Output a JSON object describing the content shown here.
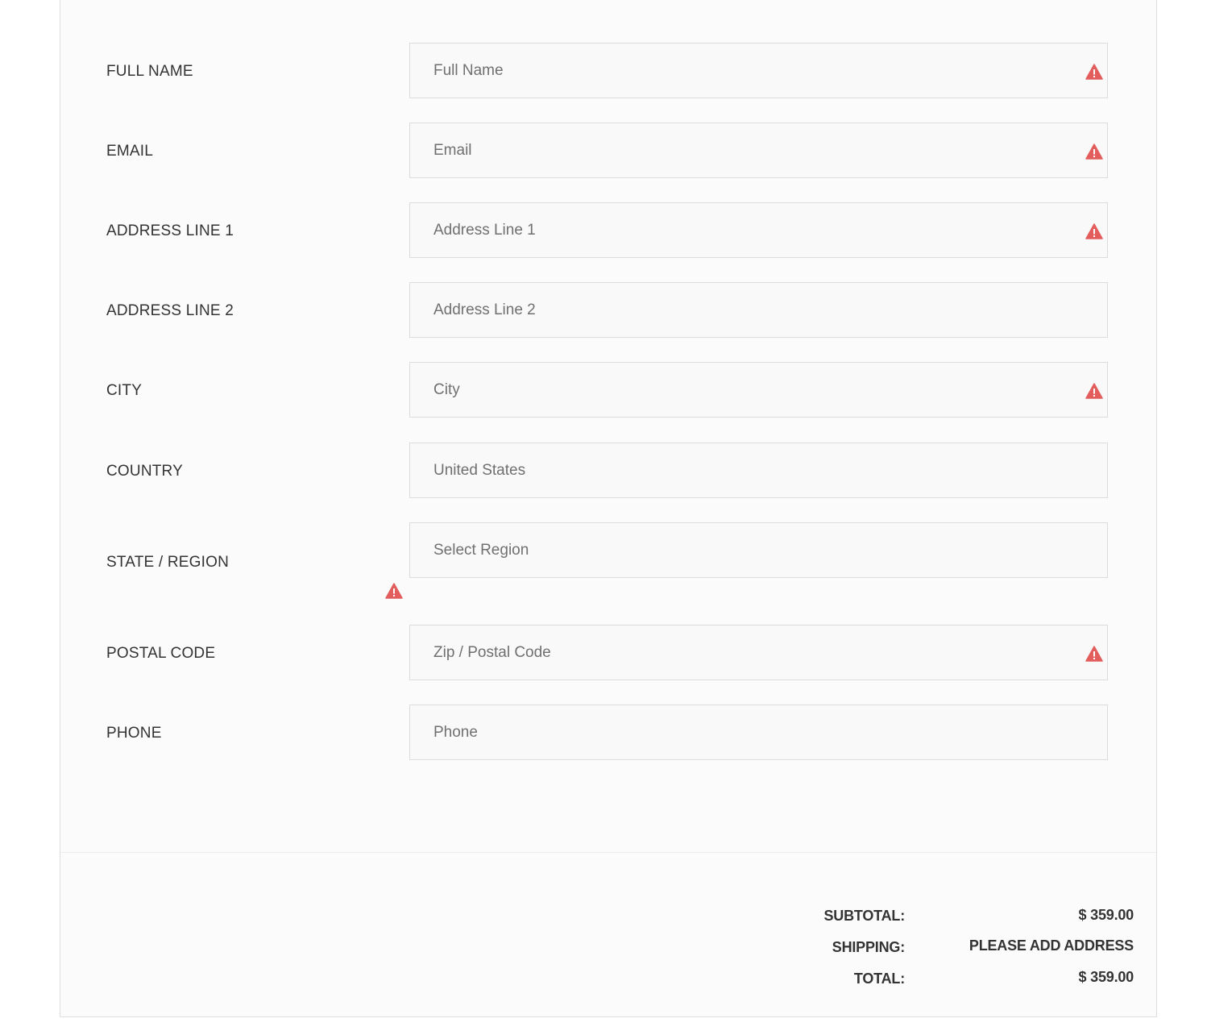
{
  "form": {
    "fields": [
      {
        "label": "FULL NAME",
        "placeholder": "Full Name",
        "error": true
      },
      {
        "label": "EMAIL",
        "placeholder": "Email",
        "error": true
      },
      {
        "label": "ADDRESS LINE 1",
        "placeholder": "Address Line 1",
        "error": true
      },
      {
        "label": "ADDRESS LINE 2",
        "placeholder": "Address Line 2",
        "error": false
      },
      {
        "label": "CITY",
        "placeholder": "City",
        "error": true
      },
      {
        "label": "COUNTRY",
        "value": "United States",
        "error": false
      },
      {
        "label": "STATE / REGION",
        "value": "Select Region",
        "error": true
      },
      {
        "label": "POSTAL CODE",
        "placeholder": "Zip / Postal Code",
        "error": true
      },
      {
        "label": "PHONE",
        "placeholder": "Phone",
        "error": false
      }
    ]
  },
  "summary": {
    "subtotal_label": "SUBTOTAL:",
    "subtotal_value": "$ 359.00",
    "shipping_label": "SHIPPING:",
    "shipping_value": "PLEASE ADD ADDRESS",
    "total_label": "TOTAL:",
    "total_value": "$ 359.00"
  },
  "colors": {
    "error": "#e35d5d",
    "field_border": "#dcdcdc",
    "panel_bg": "#fbfbfb"
  },
  "icons": {
    "field_error": "warning-triangle-icon"
  }
}
